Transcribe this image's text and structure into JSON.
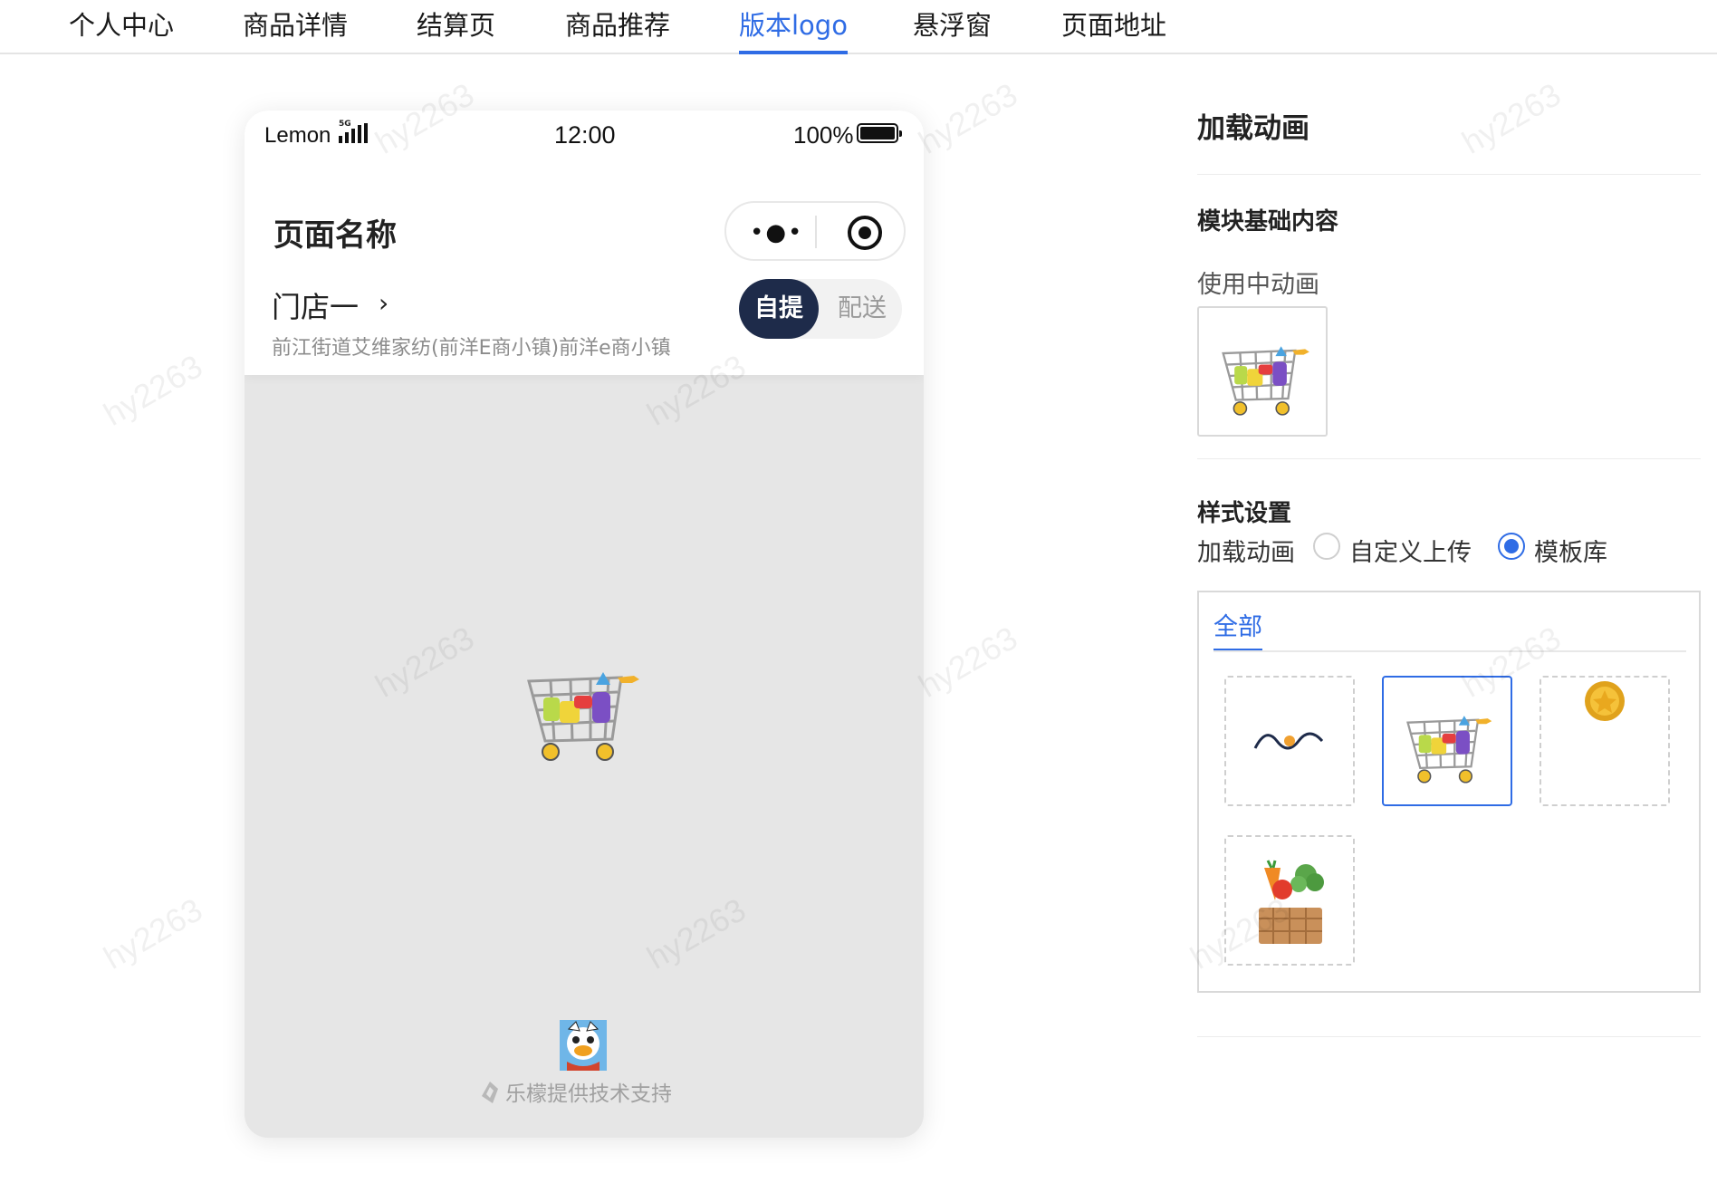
{
  "nav": {
    "tabs": [
      {
        "label": "个人中心"
      },
      {
        "label": "商品详情"
      },
      {
        "label": "结算页"
      },
      {
        "label": "商品推荐"
      },
      {
        "label": "版本logo",
        "active": true
      },
      {
        "label": "悬浮窗"
      },
      {
        "label": "页面地址"
      }
    ]
  },
  "phone": {
    "status": {
      "carrier": "Lemon",
      "network": "5G",
      "time": "12:00",
      "battery": "100%"
    },
    "page_name": "页面名称",
    "capsule": {
      "more_glyph": "•●•"
    },
    "store": {
      "name": "门店一",
      "arrow": "›",
      "address": "前江街道艾维家纺(前洋E商小镇)前洋e商小镇"
    },
    "mode": {
      "pickup": "自提",
      "delivery": "配送",
      "selected": "pickup"
    },
    "loading_icon": "shopping-cart-icon",
    "footer": {
      "powered_by": "乐檬提供技术支持"
    }
  },
  "panel": {
    "title": "加载动画",
    "basic_section": {
      "title": "模块基础内容",
      "in_use_label": "使用中动画",
      "in_use_icon": "shopping-cart-icon"
    },
    "style_section": {
      "title": "样式设置",
      "loading_label": "加载动画",
      "options": [
        {
          "label": "自定义上传",
          "checked": false
        },
        {
          "label": "模板库",
          "checked": true
        }
      ]
    },
    "library": {
      "tab": "全部",
      "items": [
        {
          "icon": "wave-dot-icon",
          "selected": false
        },
        {
          "icon": "shopping-cart-icon",
          "selected": true
        },
        {
          "icon": "gold-coin-icon",
          "selected": false
        },
        {
          "icon": "vegetable-basket-icon",
          "selected": false
        }
      ]
    }
  },
  "watermark": "hy2263",
  "colors": {
    "accent": "#2f6ce5",
    "pickup_bg": "#1e2b4a",
    "phone_bg": "#e6e6e6"
  }
}
